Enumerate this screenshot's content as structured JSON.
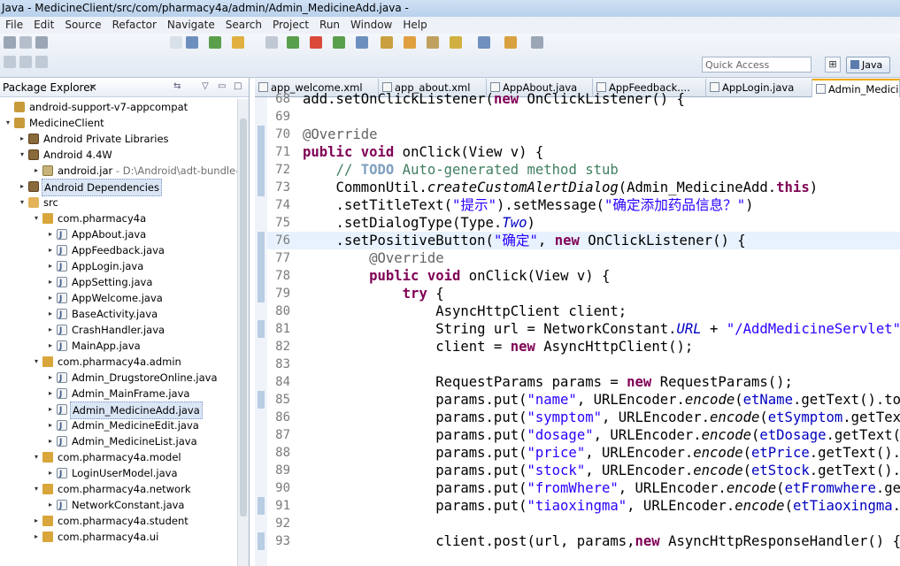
{
  "window": {
    "title": "Java - MedicineClient/src/com/pharmacy4a/admin/Admin_MedicineAdd.java - "
  },
  "menu": [
    "File",
    "Edit",
    "Source",
    "Refactor",
    "Navigate",
    "Search",
    "Project",
    "Run",
    "Window",
    "Help"
  ],
  "toolbar": {
    "quick_access_placeholder": "Quick Access",
    "perspective_label": "Java"
  },
  "package_explorer": {
    "title": "Package Explorer",
    "close_glyph": "✕",
    "tree": [
      {
        "label": "android-support-v7-appcompat",
        "indent": 0,
        "twisty": "",
        "icon": "proj"
      },
      {
        "label": "MedicineClient",
        "indent": 0,
        "twisty": "▾",
        "icon": "proj"
      },
      {
        "label": "Android Private Libraries",
        "indent": 1,
        "twisty": "▸",
        "icon": "lib"
      },
      {
        "label": "Android 4.4W",
        "indent": 1,
        "twisty": "▾",
        "icon": "lib"
      },
      {
        "label": "android.jar",
        "suffix": " - D:\\Android\\adt-bundle-wir",
        "indent": 2,
        "twisty": "▸",
        "icon": "jar"
      },
      {
        "label": "Android Dependencies",
        "indent": 1,
        "twisty": "▸",
        "icon": "lib",
        "selected": true
      },
      {
        "label": "src",
        "indent": 1,
        "twisty": "▾",
        "icon": "src"
      },
      {
        "label": "com.pharmacy4a",
        "indent": 2,
        "twisty": "▾",
        "icon": "pkg"
      },
      {
        "label": "AppAbout.java",
        "indent": 3,
        "twisty": "▸",
        "icon": "file"
      },
      {
        "label": "AppFeedback.java",
        "indent": 3,
        "twisty": "▸",
        "icon": "file"
      },
      {
        "label": "AppLogin.java",
        "indent": 3,
        "twisty": "▸",
        "icon": "file"
      },
      {
        "label": "AppSetting.java",
        "indent": 3,
        "twisty": "▸",
        "icon": "file"
      },
      {
        "label": "AppWelcome.java",
        "indent": 3,
        "twisty": "▸",
        "icon": "file"
      },
      {
        "label": "BaseActivity.java",
        "indent": 3,
        "twisty": "▸",
        "icon": "file"
      },
      {
        "label": "CrashHandler.java",
        "indent": 3,
        "twisty": "▸",
        "icon": "file"
      },
      {
        "label": "MainApp.java",
        "indent": 3,
        "twisty": "▸",
        "icon": "file"
      },
      {
        "label": "com.pharmacy4a.admin",
        "indent": 2,
        "twisty": "▾",
        "icon": "pkg"
      },
      {
        "label": "Admin_DrugstoreOnline.java",
        "indent": 3,
        "twisty": "▸",
        "icon": "file"
      },
      {
        "label": "Admin_MainFrame.java",
        "indent": 3,
        "twisty": "▸",
        "icon": "file"
      },
      {
        "label": "Admin_MedicineAdd.java",
        "indent": 3,
        "twisty": "▸",
        "icon": "file",
        "selected": true
      },
      {
        "label": "Admin_MedicineEdit.java",
        "indent": 3,
        "twisty": "▸",
        "icon": "file"
      },
      {
        "label": "Admin_MedicineList.java",
        "indent": 3,
        "twisty": "▸",
        "icon": "file"
      },
      {
        "label": "com.pharmacy4a.model",
        "indent": 2,
        "twisty": "▾",
        "icon": "pkg"
      },
      {
        "label": "LoginUserModel.java",
        "indent": 3,
        "twisty": "▸",
        "icon": "file"
      },
      {
        "label": "com.pharmacy4a.network",
        "indent": 2,
        "twisty": "▾",
        "icon": "pkg"
      },
      {
        "label": "NetworkConstant.java",
        "indent": 3,
        "twisty": "▸",
        "icon": "file"
      },
      {
        "label": "com.pharmacy4a.student",
        "indent": 2,
        "twisty": "▸",
        "icon": "pkg"
      },
      {
        "label": "com.pharmacy4a.ui",
        "indent": 2,
        "twisty": "▸",
        "icon": "pkg"
      }
    ]
  },
  "editor": {
    "tabs": [
      {
        "label": "app_welcome.xml",
        "active": false
      },
      {
        "label": "app_about.xml",
        "active": false
      },
      {
        "label": "AppAbout.java",
        "active": false
      },
      {
        "label": "AppFeedback....",
        "active": false
      },
      {
        "label": "AppLogin.java",
        "active": false
      },
      {
        "label": "Admin_Medici...",
        "active": true
      }
    ],
    "lines": [
      {
        "n": "68",
        "html": "<span>add.setOnClickListener(</span><span class=\"kw\">new</span><span> OnClickListener() {</span>"
      },
      {
        "n": "69",
        "html": ""
      },
      {
        "n": "70",
        "html": "<span class=\"ann\">@Override</span>"
      },
      {
        "n": "71",
        "html": "<span class=\"kw\">public</span> <span class=\"kw\">void</span> onClick(View v) {"
      },
      {
        "n": "72",
        "html": "    <span class=\"cm\">// </span><span class=\"todo\">TODO</span><span class=\"cm\"> Auto-generated method stub</span>"
      },
      {
        "n": "73",
        "html": "    CommonUtil.<span class=\"it\">createCustomAlertDialog</span>(Admin_MedicineAdd.<span class=\"kw\">this</span>)"
      },
      {
        "n": "74",
        "html": "    .setTitleText(<span class=\"str\">\"提示\"</span>).setMessage(<span class=\"str\">\"确定添加药品信息？\"</span>)"
      },
      {
        "n": "75",
        "html": "    .setDialogType(Type.<span class=\"sfld\">Two</span>)"
      },
      {
        "n": "76",
        "html": "    .setPositiveButton(<span class=\"str\">\"确定\"</span>, <span class=\"kw\">new</span> OnClickListener() {",
        "hl": true
      },
      {
        "n": "77",
        "html": "        <span class=\"ann\">@Override</span>"
      },
      {
        "n": "78",
        "html": "        <span class=\"kw\">public</span> <span class=\"kw\">void</span> onClick(View v) {"
      },
      {
        "n": "79",
        "html": "            <span class=\"kw\">try</span> {"
      },
      {
        "n": "80",
        "html": "                AsyncHttpClient client;"
      },
      {
        "n": "81",
        "html": "                String url = NetworkConstant.<span class=\"sfld\">URL</span> + <span class=\"str\">\"/AddMedicineServlet\"</span>;"
      },
      {
        "n": "82",
        "html": "                client = <span class=\"kw\">new</span> AsyncHttpClient();"
      },
      {
        "n": "83",
        "html": ""
      },
      {
        "n": "84",
        "html": "                RequestParams params = <span class=\"kw\">new</span> RequestParams();"
      },
      {
        "n": "85",
        "html": "                params.put(<span class=\"str\">\"name\"</span>, URLEncoder.<span class=\"it\">encode</span>(<span class=\"fld\">etName</span>.getText().toStr"
      },
      {
        "n": "86",
        "html": "                params.put(<span class=\"str\">\"symptom\"</span>, URLEncoder.<span class=\"it\">encode</span>(<span class=\"fld\">etSymptom</span>.getText()"
      },
      {
        "n": "87",
        "html": "                params.put(<span class=\"str\">\"dosage\"</span>, URLEncoder.<span class=\"it\">encode</span>(<span class=\"fld\">etDosage</span>.getText().t"
      },
      {
        "n": "88",
        "html": "                params.put(<span class=\"str\">\"price\"</span>, URLEncoder.<span class=\"it\">encode</span>(<span class=\"fld\">etPrice</span>.getText().toS"
      },
      {
        "n": "89",
        "html": "                params.put(<span class=\"str\">\"stock\"</span>, URLEncoder.<span class=\"it\">encode</span>(<span class=\"fld\">etStock</span>.getText().toS"
      },
      {
        "n": "90",
        "html": "                params.put(<span class=\"str\">\"fromWhere\"</span>, URLEncoder.<span class=\"it\">encode</span>(<span class=\"fld\">etFromwhere</span>.getTe"
      },
      {
        "n": "91",
        "html": "                params.put(<span class=\"str\">\"tiaoxingma\"</span>, URLEncoder.<span class=\"it\">encode</span>(<span class=\"fld\">etTiaoxingma</span>.get"
      },
      {
        "n": "92",
        "html": ""
      },
      {
        "n": "93",
        "html": "                client.post(url, params,<span class=\"kw\">new</span> AsyncHttpResponseHandler() {"
      }
    ]
  },
  "colors": {
    "accent": "#f1a900",
    "keyword": "#7f0055",
    "string": "#2a00ff",
    "comment": "#3f7f5f",
    "selection": "#dbe6f5"
  }
}
